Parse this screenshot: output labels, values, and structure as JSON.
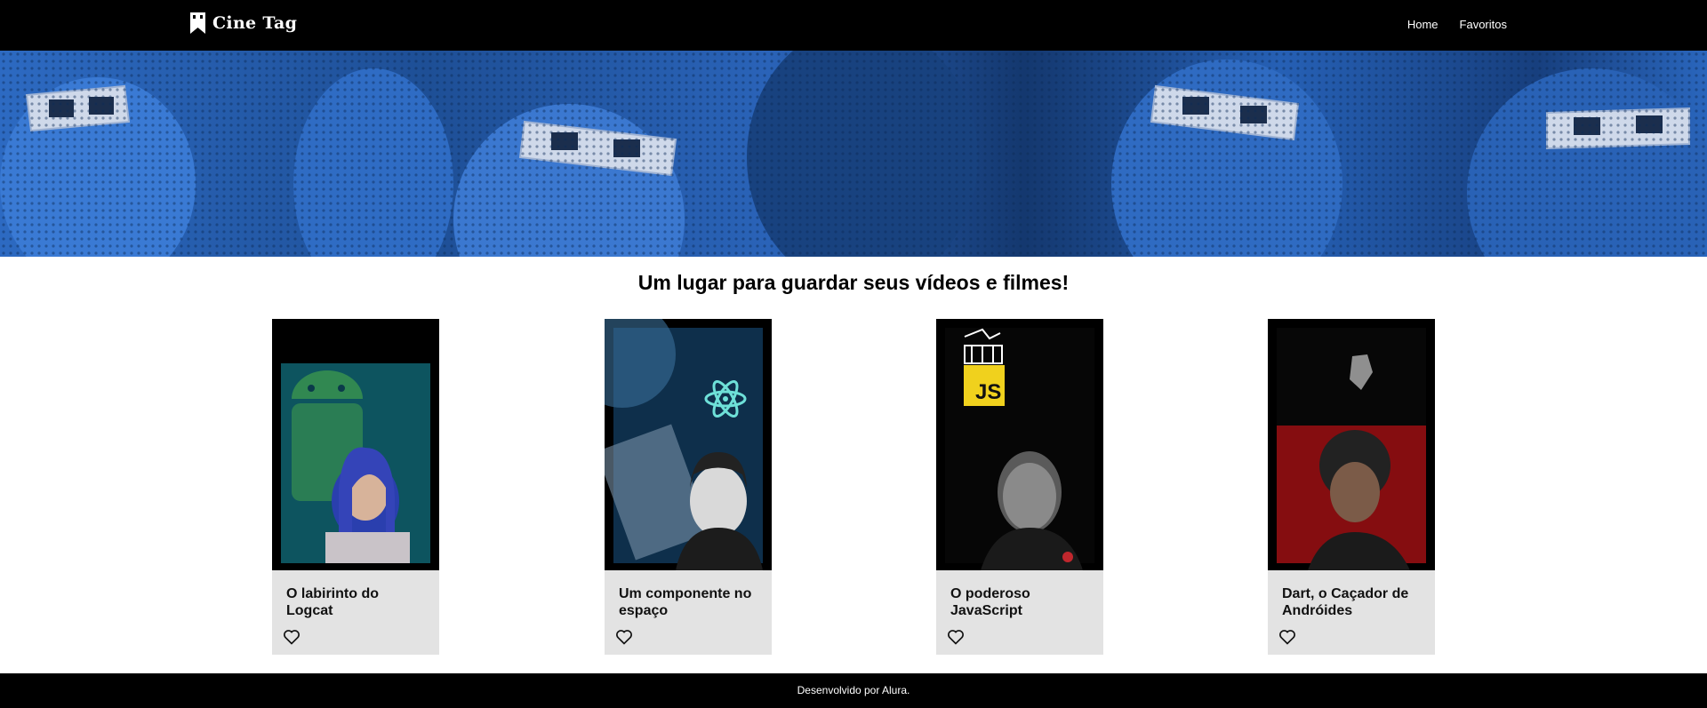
{
  "header": {
    "logo_text": "Cine Tag",
    "nav": [
      {
        "label": "Home"
      },
      {
        "label": "Favoritos"
      }
    ]
  },
  "banner": {
    "icon": "banner-image"
  },
  "tagline": "Um lugar para guardar seus vídeos e filmes!",
  "cards": [
    {
      "title": "O labirinto do Logcat",
      "icon": "heart-outline-icon"
    },
    {
      "title": "Um componente no espaço",
      "icon": "heart-outline-icon"
    },
    {
      "title": "O poderoso JavaScript",
      "icon": "heart-outline-icon"
    },
    {
      "title": "Dart, o Caçador de Andróides",
      "icon": "heart-outline-icon"
    }
  ],
  "footer": {
    "text": "Desenvolvido por Alura."
  }
}
